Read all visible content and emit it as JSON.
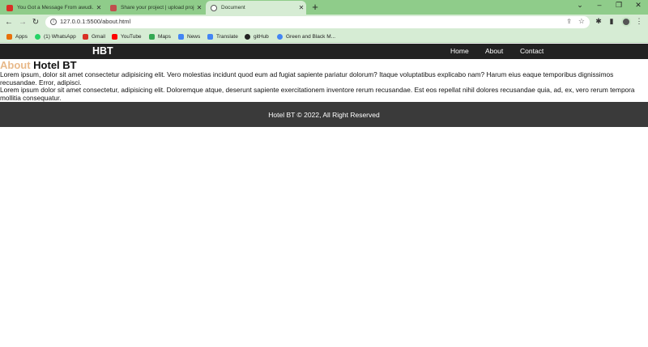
{
  "browser": {
    "tabs": [
      {
        "title": "You Got a Message From awudi...",
        "active": false,
        "favicon_color": "#d93025"
      },
      {
        "title": "Share your project | upload proje...",
        "active": false,
        "favicon_color": "#c0504d"
      },
      {
        "title": "Document",
        "active": true,
        "favicon_color": "#555555"
      }
    ],
    "new_tab_icon": "+",
    "address": "127.0.0.1:5500/about.html",
    "bookmarks": [
      {
        "label": "Apps",
        "icon": "apps-grid-icon",
        "color": "#e8710a"
      },
      {
        "label": "(1) WhatsApp",
        "icon": "whatsapp-icon",
        "color": "#25d366"
      },
      {
        "label": "Gmail",
        "icon": "gmail-icon",
        "color": "#d93025"
      },
      {
        "label": "YouTube",
        "icon": "youtube-icon",
        "color": "#ff0000"
      },
      {
        "label": "Maps",
        "icon": "maps-icon",
        "color": "#34a853"
      },
      {
        "label": "News",
        "icon": "news-icon",
        "color": "#4285f4"
      },
      {
        "label": "Translate",
        "icon": "translate-icon",
        "color": "#4285f4"
      },
      {
        "label": "gitHub",
        "icon": "github-icon",
        "color": "#222222"
      },
      {
        "label": "Green and Black M...",
        "icon": "globe-icon",
        "color": "#4285f4"
      }
    ],
    "colors": {
      "frame": "#8fcc8a",
      "toolbar": "#d6ecd4"
    }
  },
  "site": {
    "brand": "HBT",
    "nav": [
      {
        "label": "Home"
      },
      {
        "label": "About"
      },
      {
        "label": "Contact"
      }
    ],
    "heading_accent": "About",
    "heading_rest": " Hotel BT",
    "paragraphs": [
      "Lorem ipsum, dolor sit amet consectetur adipisicing elit. Vero molestias incidunt quod eum ad fugiat sapiente pariatur dolorum? Itaque voluptatibus explicabo nam? Harum eius eaque temporibus dignissimos recusandae. Error, adipisci.",
      "Lorem ipsum dolor sit amet consectetur, adipisicing elit. Doloremque atque, deserunt sapiente exercitationem inventore rerum recusandae. Est eos repellat nihil dolores recusandae quia, ad, ex, vero rerum tempora mollitia consequatur."
    ],
    "footer": "Hotel BT © 2022, All Right Reserved",
    "colors": {
      "nav_bg": "#222222",
      "footer_bg": "#3a3a3a",
      "accent": "#e8b98a"
    }
  }
}
